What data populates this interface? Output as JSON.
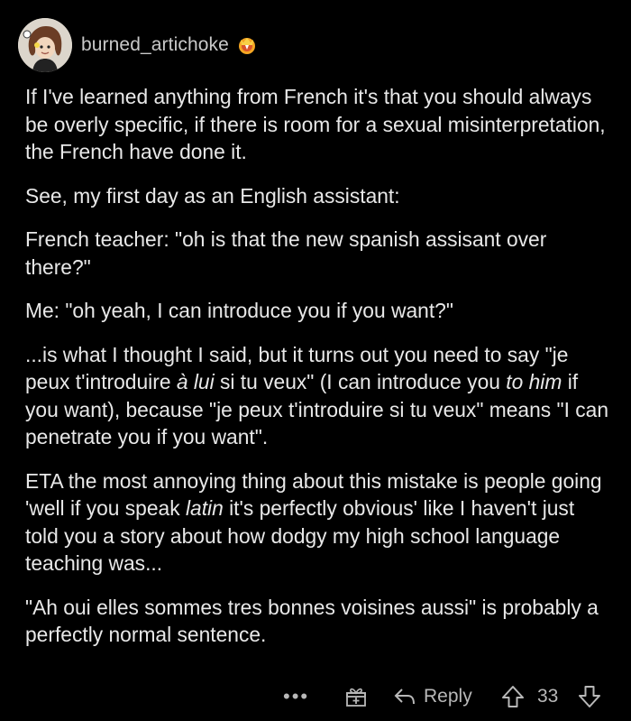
{
  "comment": {
    "username": "burned_artichoke",
    "avatar_icon": "avatar-icon",
    "award_icon": "award-icon",
    "paragraphs": {
      "p1": "If I've learned anything from French it's that you should always be overly specific, if there is room for a sexual misinterpretation, the French have done it.",
      "p2": "See, my first day as an English assistant:",
      "p3": "French teacher: \"oh is that the new spanish assisant over there?\"",
      "p4": "Me: \"oh yeah, I can introduce you if you want?\"",
      "p5": {
        "a": "...is what I thought I said, but it turns out you need to say \"je peux t'introduire ",
        "b": "à lui",
        "c": " si tu veux\" (I can introduce you ",
        "d": "to him",
        "e": " if you want), because \"je peux t'introduire si tu veux\" means \"I can penetrate you if you want\"."
      },
      "p6": {
        "a": "ETA the most annoying thing about this mistake is people going 'well if you speak ",
        "b": "latin",
        "c": " it's perfectly obvious' like I haven't just told you a story about how dodgy my high school language teaching was..."
      },
      "p7": "\"Ah oui elles sommes tres bonnes voisines aussi\" is probably a perfectly normal sentence."
    }
  },
  "actions": {
    "more_label": "•••",
    "reply_label": "Reply",
    "score": "33",
    "icons": [
      "more-icon",
      "gift-icon",
      "reply-icon",
      "upvote-icon",
      "downvote-icon"
    ]
  },
  "colors": {
    "background": "#000000",
    "text": "#e8e8e8",
    "muted": "#b8b8b8"
  }
}
